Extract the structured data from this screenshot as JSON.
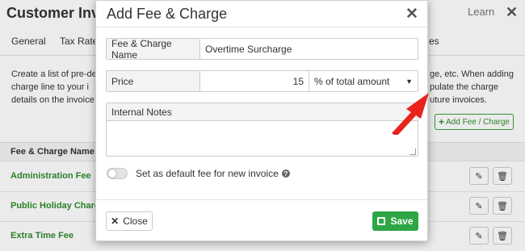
{
  "background": {
    "title": "Customer Invoi",
    "learn_label": "Learn",
    "tabs": [
      "General",
      "Tax Rate",
      "es"
    ],
    "description_left": "Create a list of pre-de a charge line to your i details on the invoice",
    "description_right": "ge, etc. When adding pulate the charge uture invoices.",
    "add_button_label": "Add Fee / Charge",
    "table_header": "Fee & Charge Name",
    "rows": [
      {
        "name": "Administration Fee"
      },
      {
        "name": "Public Holiday Charge"
      },
      {
        "name": "Extra Time Fee"
      }
    ]
  },
  "modal": {
    "title": "Add Fee & Charge",
    "name_label": "Fee & Charge Name",
    "name_value": "Overtime Surcharge",
    "price_label": "Price",
    "price_value": "15",
    "price_type": "% of total amount",
    "notes_label": "Internal Notes",
    "notes_value": "",
    "default_toggle_label": "Set as default fee for new invoice",
    "default_toggle_on": false,
    "close_label": "Close",
    "save_label": "Save"
  },
  "colors": {
    "accent_green": "#2ea645",
    "link_green": "#2f8c2f",
    "arrow_red": "#e8231c"
  },
  "icons": [
    "close-x-icon",
    "help-icon",
    "save-icon",
    "edit-icon",
    "trash-icon",
    "plus-icon",
    "chevron-down-icon",
    "red-arrow"
  ]
}
